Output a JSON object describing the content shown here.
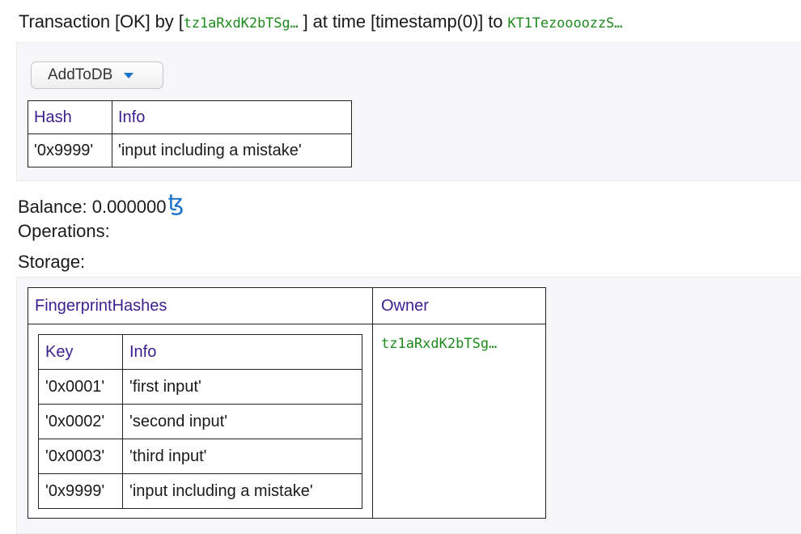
{
  "transaction": {
    "prefix": "Transaction [OK] by [",
    "sender": "tz1aRxdK2bTSg…",
    "middle": " ] at time [timestamp(0)] to ",
    "target": "KT1TezoooozzS…"
  },
  "action": {
    "dropdown_label": "AddToDB"
  },
  "params_table": {
    "headers": [
      "Hash",
      "Info"
    ],
    "rows": [
      [
        "'0x9999'",
        "'input including a mistake'"
      ]
    ]
  },
  "balance": {
    "label": "Balance: 0.000000",
    "currency_symbol": "ꜩ"
  },
  "operations_label": "Operations:",
  "storage_label": "Storage:",
  "storage": {
    "headers": [
      "FingerprintHashes",
      "Owner"
    ],
    "owner": "tz1aRxdK2bTSg…",
    "fingerprints": {
      "headers": [
        "Key",
        "Info"
      ],
      "rows": [
        [
          "'0x0001'",
          "'first input'"
        ],
        [
          "'0x0002'",
          "'second input'"
        ],
        [
          "'0x0003'",
          "'third input'"
        ],
        [
          "'0x9999'",
          "'input including a mistake'"
        ]
      ]
    }
  },
  "colors": {
    "address_green": "#1e8a1e",
    "header_purple": "#3b1f8f",
    "tez_blue": "#1a73c8"
  }
}
